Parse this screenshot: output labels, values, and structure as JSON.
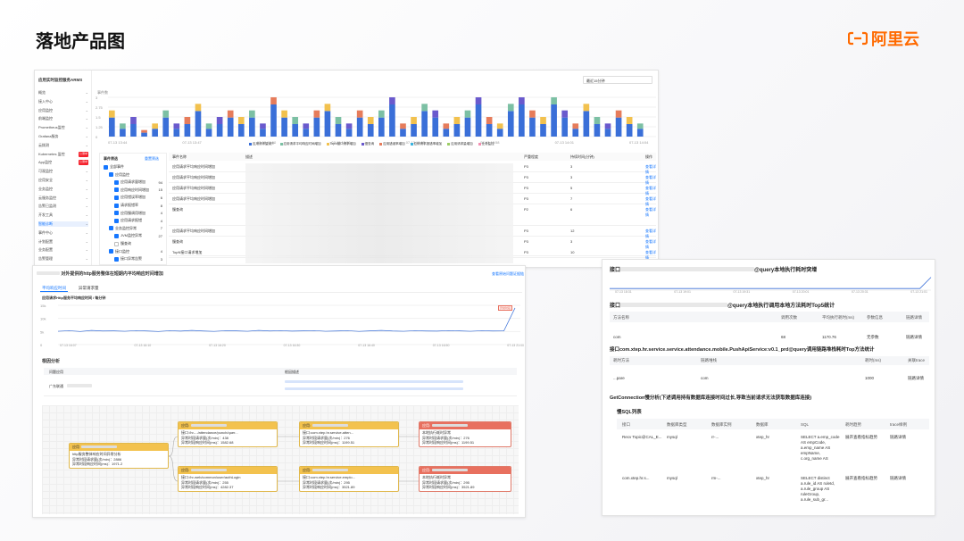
{
  "slide": {
    "title": "落地产品图",
    "logo_text": "阿里云",
    "logo_color": "#ff6a00"
  },
  "shot1": {
    "app_title": "应用实时监控服务ARMS",
    "sidebar": [
      {
        "label": "概览"
      },
      {
        "label": "接入中心"
      },
      {
        "label": "应用监控"
      },
      {
        "label": "前端监控"
      },
      {
        "label": "Prometheus监控"
      },
      {
        "label": "Grafana服务"
      },
      {
        "label": "云拨测"
      },
      {
        "label": "Kubernetes 监控",
        "badge": "公测中"
      },
      {
        "label": "App监控",
        "badge": "公测中"
      },
      {
        "label": "可观监控"
      },
      {
        "label": "应用安全"
      },
      {
        "label": "业务监控"
      },
      {
        "label": "云服务监控"
      },
      {
        "label": "告警已监测"
      },
      {
        "label": "开发工具"
      },
      {
        "label": "智能诊断"
      },
      {
        "label": "事件中心"
      },
      {
        "label": "计划配置"
      },
      {
        "label": "业务配置"
      },
      {
        "label": "告警管理"
      }
    ],
    "time_select": "最近15分钟",
    "chart_label": "事件数",
    "y_ticks": [
      "3",
      "2.75",
      "1.5",
      "1.25",
      "0"
    ],
    "x_ticks": [
      "07-13 13:44",
      "07-13 13:47",
      "07-13 13:50",
      "07-13 13:52",
      "07-13 13:55",
      "07-13 13:58",
      "07-13 14:01",
      "07-13 14:04"
    ],
    "legend": [
      "应用请求量减少",
      "应用请求平均响应时间增加",
      "TopN接口请求增加",
      "慢查询",
      "应用错误率增加",
      "应用请求报错率增加",
      "应用请求量增加",
      "业务监控"
    ],
    "filter": {
      "title": "事件筛选",
      "reset": "重置筛选",
      "items": [
        "全部事件",
        "应用监控",
        "应用请求量增加",
        "应用响应时间增加",
        "应用错误率增加",
        "请求报错率",
        "应用慢调用增加",
        "应用请求报错",
        "业务监控异常",
        "JVM监控异常",
        "慢查询",
        "接口监控",
        "接口异常告警"
      ],
      "counts": [
        "",
        "",
        "94",
        "15",
        "6",
        "8",
        "4",
        "4",
        "7",
        "27",
        "",
        "4",
        "3"
      ]
    },
    "table": {
      "headers": [
        "事件名称",
        "描述",
        "严重程度",
        "持续时间(分钟)",
        "操作"
      ],
      "rows": [
        {
          "name": "应用请求平均响应时间增加",
          "level": "P3",
          "dur": "3",
          "op": "查看详情"
        },
        {
          "name": "应用请求平均响应时间增加",
          "level": "P3",
          "dur": "3",
          "op": "查看详情"
        },
        {
          "name": "应用请求平均响应时间增加",
          "level": "P3",
          "dur": "5",
          "op": "查看详情"
        },
        {
          "name": "应用请求平均响应时间增加",
          "level": "P3",
          "dur": "7",
          "op": "查看详情"
        },
        {
          "name": "慢查询",
          "level": "P2",
          "dur": "6",
          "op": "查看详情"
        },
        {
          "name": "应用请求平均响应时间增加",
          "level": "P3",
          "dur": "12",
          "op": "查看详情"
        },
        {
          "name": "慢查询",
          "level": "P3",
          "dur": "3",
          "op": "查看详情"
        },
        {
          "name": "TopN接口请求增加",
          "level": "P3",
          "dur": "10",
          "op": "查看详情"
        }
      ]
    },
    "pager": [
      "2",
      "3",
      "4",
      "…",
      "11",
      "下一页"
    ]
  },
  "shot2": {
    "title": "对外提供的http服务整体在短期内平均响应时间增加",
    "link": "查看原始问题证据链",
    "tabs": [
      "平均响应时间",
      "异常请求量"
    ],
    "chart_title": "应用请求Http服务平均响应时间 / 每分钟",
    "y_ticks": [
      "15k",
      "10k",
      "5k",
      "0"
    ],
    "x_ticks": [
      "07-13 16:07",
      "07-13 16:10",
      "07-13 16:20",
      "07-13 16:30",
      "07-13 16:40",
      "07-13 16:50",
      "07-13 21:00"
    ],
    "peak_label": "异常时段",
    "section": "根因分析",
    "root_headers": [
      "问题应用",
      "根因描述"
    ],
    "root_app": "广东联通",
    "nodes": [
      {
        "hd": "应用",
        "lines": [
          "http服务整体响应时间异常分析",
          "异常时段请求量(次/min)：2886",
          "异常时段响应时间(ms)：1971.2"
        ]
      },
      {
        "hd": "应用:",
        "lines": [
          "接口:/hr-.../attendance/punch/quer...",
          "异常时段请求量(次/min)：438",
          "异常时段响应时间(ms)：1582.68"
        ]
      },
      {
        "hd": "应用:",
        "lines": [
          "接口:/hr-web/common/user/authLogin",
          "异常时段请求量(次/min)：255",
          "异常时段响应时间(ms)：4282.37"
        ]
      },
      {
        "hd": "应用:",
        "lines": [
          "接口:com.xtep.hr.service.atten...",
          "异常时段请求量(次/min)：276",
          "异常时段响应时间(ms)：1199.51"
        ]
      },
      {
        "hd": "应用:",
        "lines": [
          "接口:com.xtep.hr.service.emplo...",
          "异常时段请求量(次/min)：295",
          "异常时段响应时间(ms)：3521.89"
        ]
      },
      {
        "hd": "应用:",
        "lines": [
          "本地执行耗时异常",
          "异常时段请求量(次/min)：276",
          "异常时段响应时间(ms)：1199.51"
        ]
      },
      {
        "hd": "应用:",
        "lines": [
          "本地执行耗时异常",
          "异常时段请求量(次/min)：295",
          "异常时段响应时间(ms)：3521.89"
        ]
      }
    ]
  },
  "shot3": {
    "h1": "@query本地执行耗时突增",
    "x_ticks": [
      "07-13 18:31",
      "07-13 19:01",
      "07-13 19:31",
      "07-13 20:01",
      "07-13 20:31",
      "07-13 21:01"
    ],
    "h2": "@query本地执行调用本地方法耗时Top5统计",
    "t1_headers": [
      "方法名称",
      "调用次数",
      "平均执行耗时(ms)",
      "参数信息",
      "链路详情"
    ],
    "t1_row": [
      "com",
      "68",
      "1170.76",
      "无参数",
      "链路详情"
    ],
    "h3": "接口com.xtep.hr.service.service.attendance.mobile.PushApiService:v0.1_prd@query调用链路堆栈耗时Top方法统计",
    "t2_headers": [
      "耗时方法",
      "链路堆栈",
      "耗时(ms)",
      "关联trace"
    ],
    "t2_row": [
      "...pare",
      "com",
      "1000",
      "链路详情"
    ],
    "h4": "GetConnection慢分析(下述调用持有数据库连接时间过长,导致当前请求无法获取数据库连接)",
    "h5": "慢SQL列表",
    "t3_headers": [
      "接口",
      "数据库类型",
      "数据库实例",
      "数据库",
      "SQL",
      "耗时趋势",
      "trace样例"
    ],
    "t3_rows": [
      {
        "api": "Recv Topic@CAL_E...",
        "db_type": "mysql",
        "inst": "rr-...",
        "db": "xtep_hr",
        "sql": "SELECT a.emp_code AS empCode, a.emp_name AS empName, c.org_name AS",
        "trend": "展开查看指标趋势",
        "trace": "链路详情"
      },
      {
        "api": "com.xtep.hr.s...",
        "db_type": "mysql",
        "inst": "rm-...",
        "db": "xtep_hr",
        "sql": "SELECT distinct a.rule_id AS ruleId, a.rule_group AS ruleGroup, a.rule_sub_gr...",
        "trend": "展开查看指标趋势",
        "trace": "链路详情"
      }
    ]
  },
  "chart_data": [
    {
      "type": "bar",
      "title": "",
      "ylabel": "事件数",
      "ylim": [
        0,
        3
      ],
      "series": [
        {
          "name": "events",
          "values": [
            2,
            1,
            1.5,
            0.5,
            1,
            2,
            1,
            1.5,
            2.5,
            1,
            1.5,
            2,
            1.5,
            2,
            1,
            3,
            2,
            1.5,
            1,
            2,
            2.5,
            1.5,
            1,
            2,
            1.5,
            2,
            3,
            1,
            1.5,
            2.5,
            2,
            1,
            1.5,
            2,
            3,
            1.5,
            1,
            2.5,
            3,
            2,
            1.5,
            3,
            2,
            1,
            2.5,
            1.5,
            1,
            2,
            1.5,
            1
          ]
        }
      ]
    },
    {
      "type": "line",
      "title": "应用请求Http服务平均响应时间 / 每分钟",
      "ylim": [
        0,
        15000
      ],
      "series": [
        {
          "name": "avg_rt",
          "values": [
            5100,
            5300,
            5000,
            5400,
            5200,
            5250,
            5100,
            5350,
            5200,
            5000,
            5300,
            5150,
            5400,
            5200,
            5050,
            5300,
            5250,
            5100,
            5400,
            5200,
            5300,
            5150,
            5250,
            5350,
            5100,
            5200,
            5300,
            5050,
            5250,
            5400,
            5200,
            5100,
            5300,
            5200,
            5150,
            5350,
            5250,
            5100,
            5300,
            5200,
            5250,
            14000
          ]
        }
      ]
    },
    {
      "type": "line",
      "title": "",
      "ylim": [
        0,
        10
      ],
      "series": [
        {
          "name": "local_exec",
          "values": [
            1,
            1,
            1,
            1,
            1,
            1,
            1,
            1,
            1,
            1,
            1,
            1,
            1,
            1,
            1,
            1,
            1,
            1,
            1,
            1,
            1,
            1,
            1,
            1,
            1,
            1,
            1,
            1,
            1,
            8
          ]
        }
      ]
    }
  ]
}
